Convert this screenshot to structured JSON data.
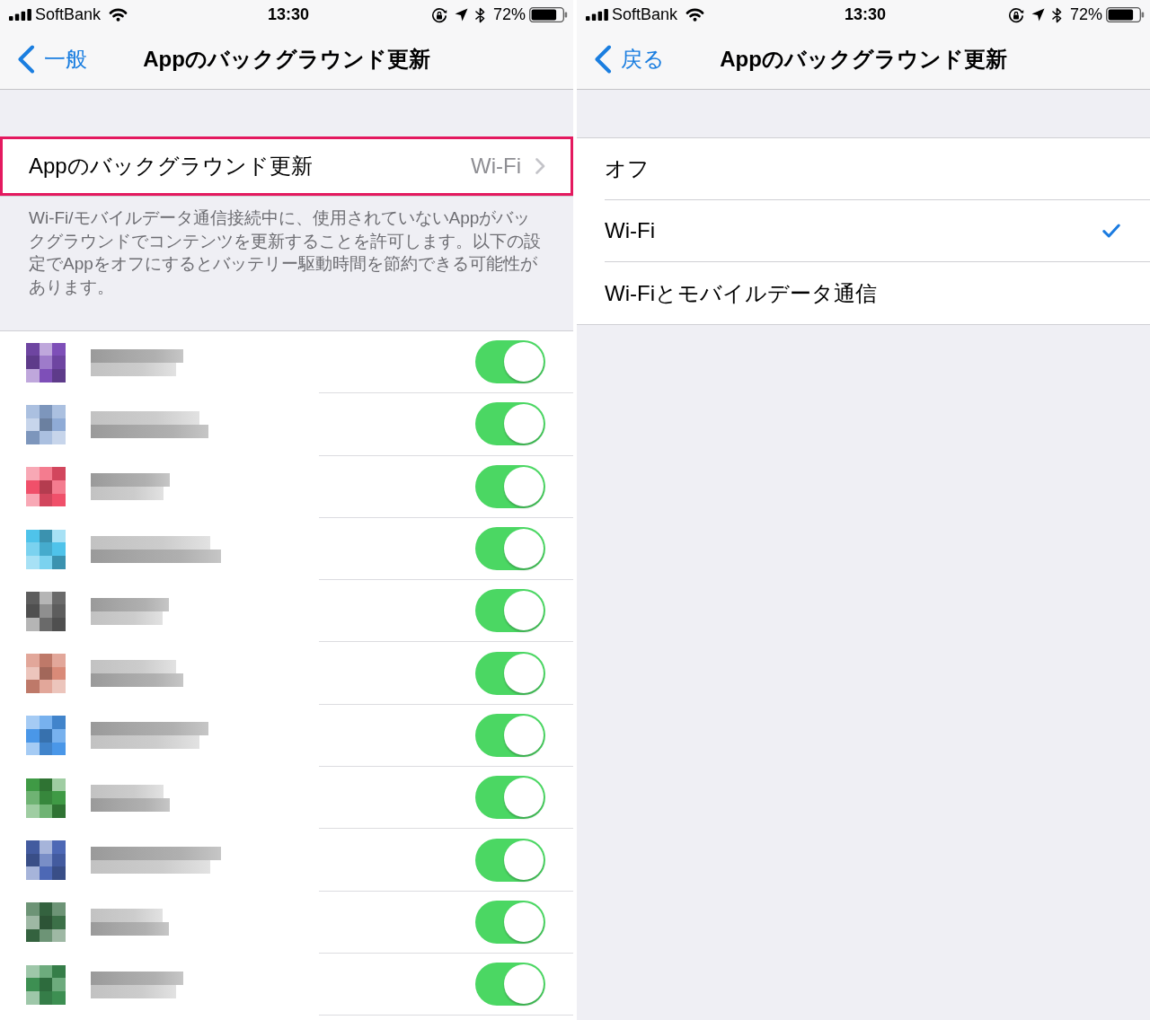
{
  "screens": [
    {
      "kind": "app_settings",
      "status_bar": {
        "carrier": "SoftBank",
        "time": "13:30",
        "battery": "72%"
      },
      "nav": {
        "back": "一般",
        "title": "Appのバックグラウンド更新"
      },
      "refresh_setting": {
        "label": "Appのバックグラウンド更新",
        "value": "Wi-Fi",
        "highlighted": true
      },
      "footer": "Wi-Fi/モバイルデータ通信接続中に、使用されていないAppがバックグラウンドでコンテンツを更新することを許可します。以下の設定でAppをオフにするとバッテリー駆動時間を節約できる可能性があります。",
      "apps": [
        {
          "color": "#7e4fb8",
          "on": true
        },
        {
          "color": "#8fabd6",
          "on": true
        },
        {
          "color": "#f0506a",
          "on": true
        },
        {
          "color": "#4fc3ea",
          "on": true
        },
        {
          "color": "#6a6a6a",
          "on": true
        },
        {
          "color": "#d98a78",
          "on": true
        },
        {
          "color": "#4a97e8",
          "on": true
        },
        {
          "color": "#3f9a45",
          "on": true
        },
        {
          "color": "#4d68b5",
          "on": true
        },
        {
          "color": "#3c7048",
          "on": true
        },
        {
          "color": "#3d8f52",
          "on": true
        }
      ]
    },
    {
      "kind": "option_list",
      "status_bar": {
        "carrier": "SoftBank",
        "time": "13:30",
        "battery": "72%"
      },
      "nav": {
        "back": "戻る",
        "title": "Appのバックグラウンド更新"
      },
      "options": [
        {
          "label": "オフ",
          "selected": false
        },
        {
          "label": "Wi-Fi",
          "selected": true
        },
        {
          "label": "Wi-Fiとモバイルデータ通信",
          "selected": false
        }
      ]
    }
  ]
}
